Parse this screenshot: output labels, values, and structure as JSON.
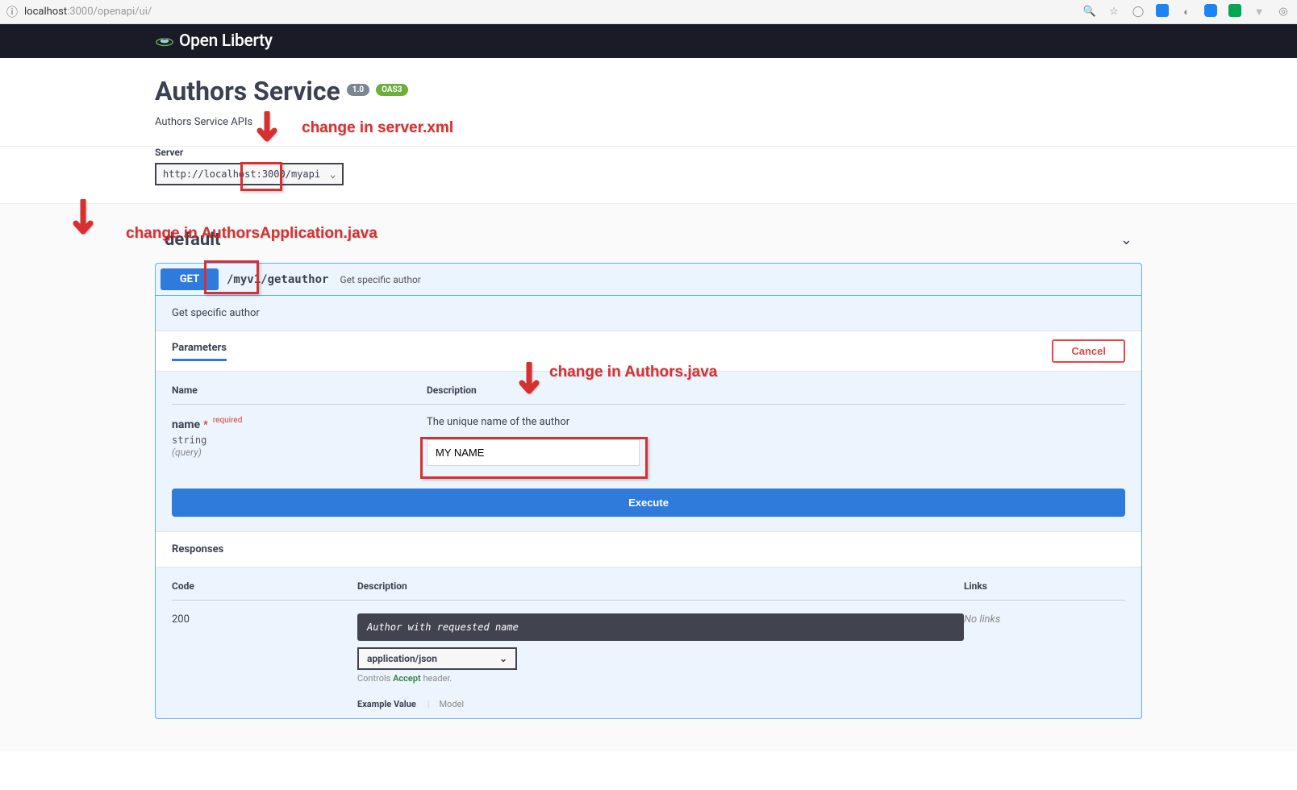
{
  "browser": {
    "host": "localhost",
    "port": ":3000",
    "path": "/openapi/ui/"
  },
  "header": {
    "brand": "Open Liberty"
  },
  "info": {
    "title": "Authors Service",
    "version_badge": "1.0",
    "oas_badge": "OAS3",
    "description": "Authors Service APIs"
  },
  "server": {
    "label": "Server",
    "value": "http://localhost:3000/myapi"
  },
  "tag": {
    "name": "default"
  },
  "operation": {
    "method": "GET",
    "path": "/myv1/getauthor",
    "summary": "Get specific author",
    "description": "Get specific author"
  },
  "params": {
    "tab_label": "Parameters",
    "cancel": "Cancel",
    "head_name": "Name",
    "head_desc": "Description",
    "p": {
      "name": "name",
      "star": "*",
      "required": "required",
      "type": "string",
      "loc": "(query)",
      "desc": "The unique name of the author",
      "value": "MY NAME"
    }
  },
  "actions": {
    "execute": "Execute"
  },
  "responses": {
    "header": "Responses",
    "head_code": "Code",
    "head_desc": "Description",
    "head_links": "Links",
    "row": {
      "code": "200",
      "desc_box": "Author with requested name",
      "media": "application/json",
      "hint_prefix": "Controls ",
      "hint_bold": "Accept",
      "hint_suffix": " header.",
      "tab1": "Example Value",
      "tab2": "Model",
      "links": "No links"
    }
  },
  "annotations": {
    "a1": "change in server.xml",
    "a2": "change in AuthorsApplication.java",
    "a3": "change in Authors.java"
  }
}
